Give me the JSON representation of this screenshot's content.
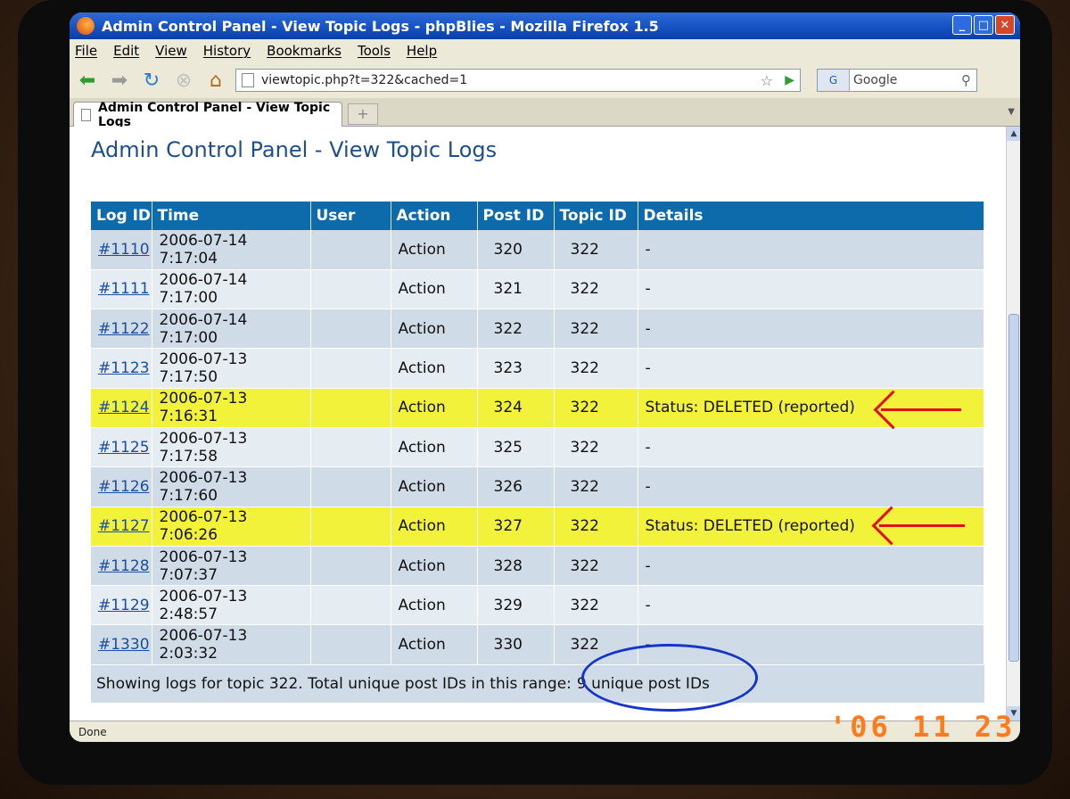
{
  "window": {
    "title": "Admin Control Panel - View Topic Logs - phpBlies - Mozilla Firefox 1.5"
  },
  "menu": [
    "File",
    "Edit",
    "View",
    "History",
    "Bookmarks",
    "Tools",
    "Help"
  ],
  "nav": {
    "url": "viewtopic.php?t=322&cached=1",
    "search_placeholder": "Google",
    "search_engine": "G"
  },
  "tab": {
    "label": "Admin Control Panel - View Topic Logs",
    "new_tab": "+"
  },
  "page": {
    "title": "Admin Control Panel - View Topic Logs"
  },
  "table": {
    "headers": [
      "Log ID",
      "Time",
      "User",
      "Action",
      "Post ID",
      "Topic ID",
      "Details"
    ],
    "rows": [
      {
        "id": "#1110",
        "time": "2006-07-14 7:17:04",
        "user": "",
        "action": "Action",
        "post": "320",
        "topic": "322",
        "details": "-",
        "highlight": false
      },
      {
        "id": "#1111",
        "time": "2006-07-14 7:17:00",
        "user": "",
        "action": "Action",
        "post": "321",
        "topic": "322",
        "details": "-",
        "highlight": false
      },
      {
        "id": "#1122",
        "time": "2006-07-14 7:17:00",
        "user": "",
        "action": "Action",
        "post": "322",
        "topic": "322",
        "details": "-",
        "highlight": false
      },
      {
        "id": "#1123",
        "time": "2006-07-13 7:17:50",
        "user": "",
        "action": "Action",
        "post": "323",
        "topic": "322",
        "details": "-",
        "highlight": false
      },
      {
        "id": "#1124",
        "time": "2006-07-13 7:16:31",
        "user": "",
        "action": "Action",
        "post": "324",
        "topic": "322",
        "details": "Status: DELETED (reported)",
        "highlight": true
      },
      {
        "id": "#1125",
        "time": "2006-07-13 7:17:58",
        "user": "",
        "action": "Action",
        "post": "325",
        "topic": "322",
        "details": "-",
        "highlight": false
      },
      {
        "id": "#1126",
        "time": "2006-07-13 7:17:60",
        "user": "",
        "action": "Action",
        "post": "326",
        "topic": "322",
        "details": "-",
        "highlight": false
      },
      {
        "id": "#1127",
        "time": "2006-07-13 7:06:26",
        "user": "",
        "action": "Action",
        "post": "327",
        "topic": "322",
        "details": "Status: DELETED (reported)",
        "highlight": true
      },
      {
        "id": "#1128",
        "time": "2006-07-13 7:07:37",
        "user": "",
        "action": "Action",
        "post": "328",
        "topic": "322",
        "details": "-",
        "highlight": false
      },
      {
        "id": "#1129",
        "time": "2006-07-13 2:48:57",
        "user": "",
        "action": "Action",
        "post": "329",
        "topic": "322",
        "details": "-",
        "highlight": false
      },
      {
        "id": "#1330",
        "time": "2006-07-13 2:03:32",
        "user": "",
        "action": "Action",
        "post": "330",
        "topic": "322",
        "details": "-",
        "highlight": false
      }
    ],
    "footer": "Showing logs for topic 322. Total unique post IDs in this range:",
    "footer_emph": "9 unique post IDs"
  },
  "status": {
    "text": "Done"
  },
  "camera": {
    "date_stamp": "'06 11 23"
  },
  "colors": {
    "header_bg": "#0d6aab",
    "highlight": "#f2f23a",
    "arrow": "#e01010",
    "circle": "#1535c8"
  }
}
